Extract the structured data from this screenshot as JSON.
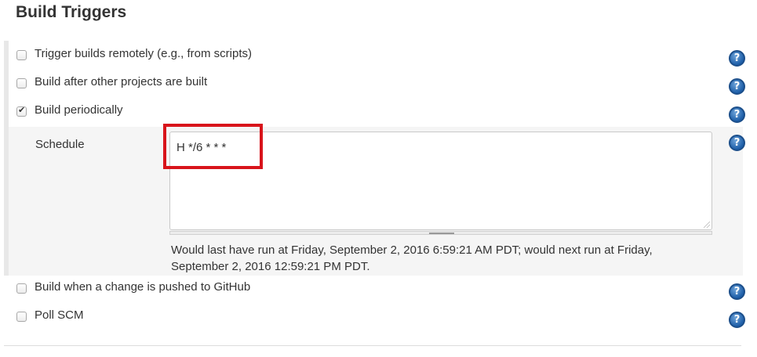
{
  "section_title": "Build Triggers",
  "triggers": [
    {
      "label": "Trigger builds remotely (e.g., from scripts)",
      "checked": false
    },
    {
      "label": "Build after other projects are built",
      "checked": false
    },
    {
      "label": "Build periodically",
      "checked": true
    }
  ],
  "schedule": {
    "label": "Schedule",
    "value": "H */6 * * *",
    "hint": "Would last have run at Friday, September 2, 2016 6:59:21 AM PDT; would next run at Friday, September 2, 2016 12:59:21 PM PDT."
  },
  "triggers_after": [
    {
      "label": "Build when a change is pushed to GitHub",
      "checked": false
    },
    {
      "label": "Poll SCM",
      "checked": false
    }
  ],
  "help_glyph": "?",
  "icons": {
    "help": "help-icon",
    "checkbox": "checkbox-icon"
  },
  "colors": {
    "highlight": "#d8141b",
    "help": "#1d5ea8",
    "panel": "#f5f5f5"
  }
}
